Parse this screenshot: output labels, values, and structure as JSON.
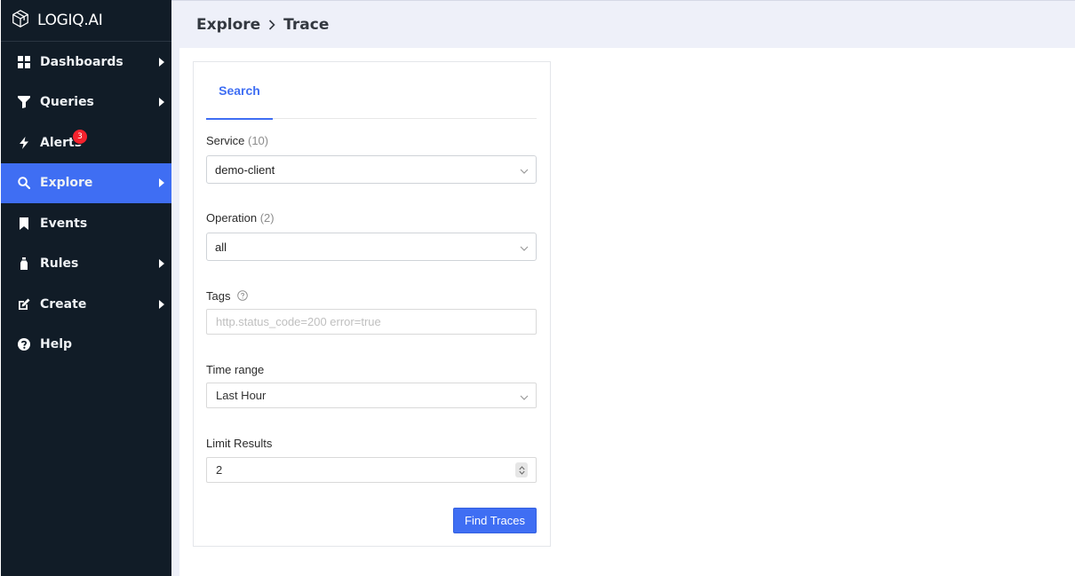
{
  "brand": {
    "name": "LOGIQ.AI",
    "logo_icon": "cube-logo-icon"
  },
  "sidebar": {
    "items": [
      {
        "label": "Dashboards",
        "icon": "grid-icon",
        "has_submenu": true,
        "active": false
      },
      {
        "label": "Queries",
        "icon": "filter-icon",
        "has_submenu": true,
        "active": false
      },
      {
        "label": "Alerts",
        "icon": "bolt-icon",
        "has_submenu": false,
        "active": false,
        "badge": "3"
      },
      {
        "label": "Explore",
        "icon": "search-icon",
        "has_submenu": true,
        "active": true
      },
      {
        "label": "Events",
        "icon": "bookmark-icon",
        "has_submenu": false,
        "active": false
      },
      {
        "label": "Rules",
        "icon": "bottle-icon",
        "has_submenu": true,
        "active": false
      },
      {
        "label": "Create",
        "icon": "edit-icon",
        "has_submenu": true,
        "active": false
      },
      {
        "label": "Help",
        "icon": "question-circle-icon",
        "has_submenu": false,
        "active": false
      }
    ]
  },
  "breadcrumb": {
    "parent": "Explore",
    "current": "Trace"
  },
  "search_panel": {
    "tab_label": "Search",
    "service": {
      "label": "Service",
      "count": "(10)",
      "value": "demo-client"
    },
    "operation": {
      "label": "Operation",
      "count": "(2)",
      "value": "all"
    },
    "tags": {
      "label": "Tags",
      "placeholder": "http.status_code=200 error=true"
    },
    "time_range": {
      "label": "Time range",
      "value": "Last Hour"
    },
    "limit": {
      "label": "Limit Results",
      "value": "2"
    },
    "submit_label": "Find Traces"
  },
  "colors": {
    "sidebar_bg": "#111c27",
    "accent": "#3f6ef3",
    "header_bg": "#eef0f9",
    "badge": "#f5222d"
  }
}
